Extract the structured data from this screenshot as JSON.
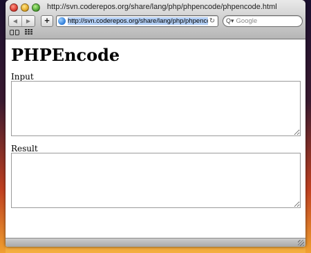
{
  "window": {
    "title": "http://svn.coderepos.org/share/lang/php/phpencode/phpencode.html"
  },
  "toolbar": {
    "back_label": "◀",
    "forward_label": "▶",
    "add_label": "+",
    "url": "http://svn.coderepos.org/share/lang/php/phpencode/phpencode.html",
    "reload_label": "↻",
    "search_placeholder": "Google"
  },
  "page": {
    "title": "PHPEncode",
    "input_label": "Input",
    "input_value": "",
    "result_label": "Result",
    "result_value": ""
  },
  "icons": {
    "bookmarks": "open-book-icon",
    "top_sites": "grid-icon",
    "site": "globe-icon",
    "search": "magnifier-icon"
  }
}
